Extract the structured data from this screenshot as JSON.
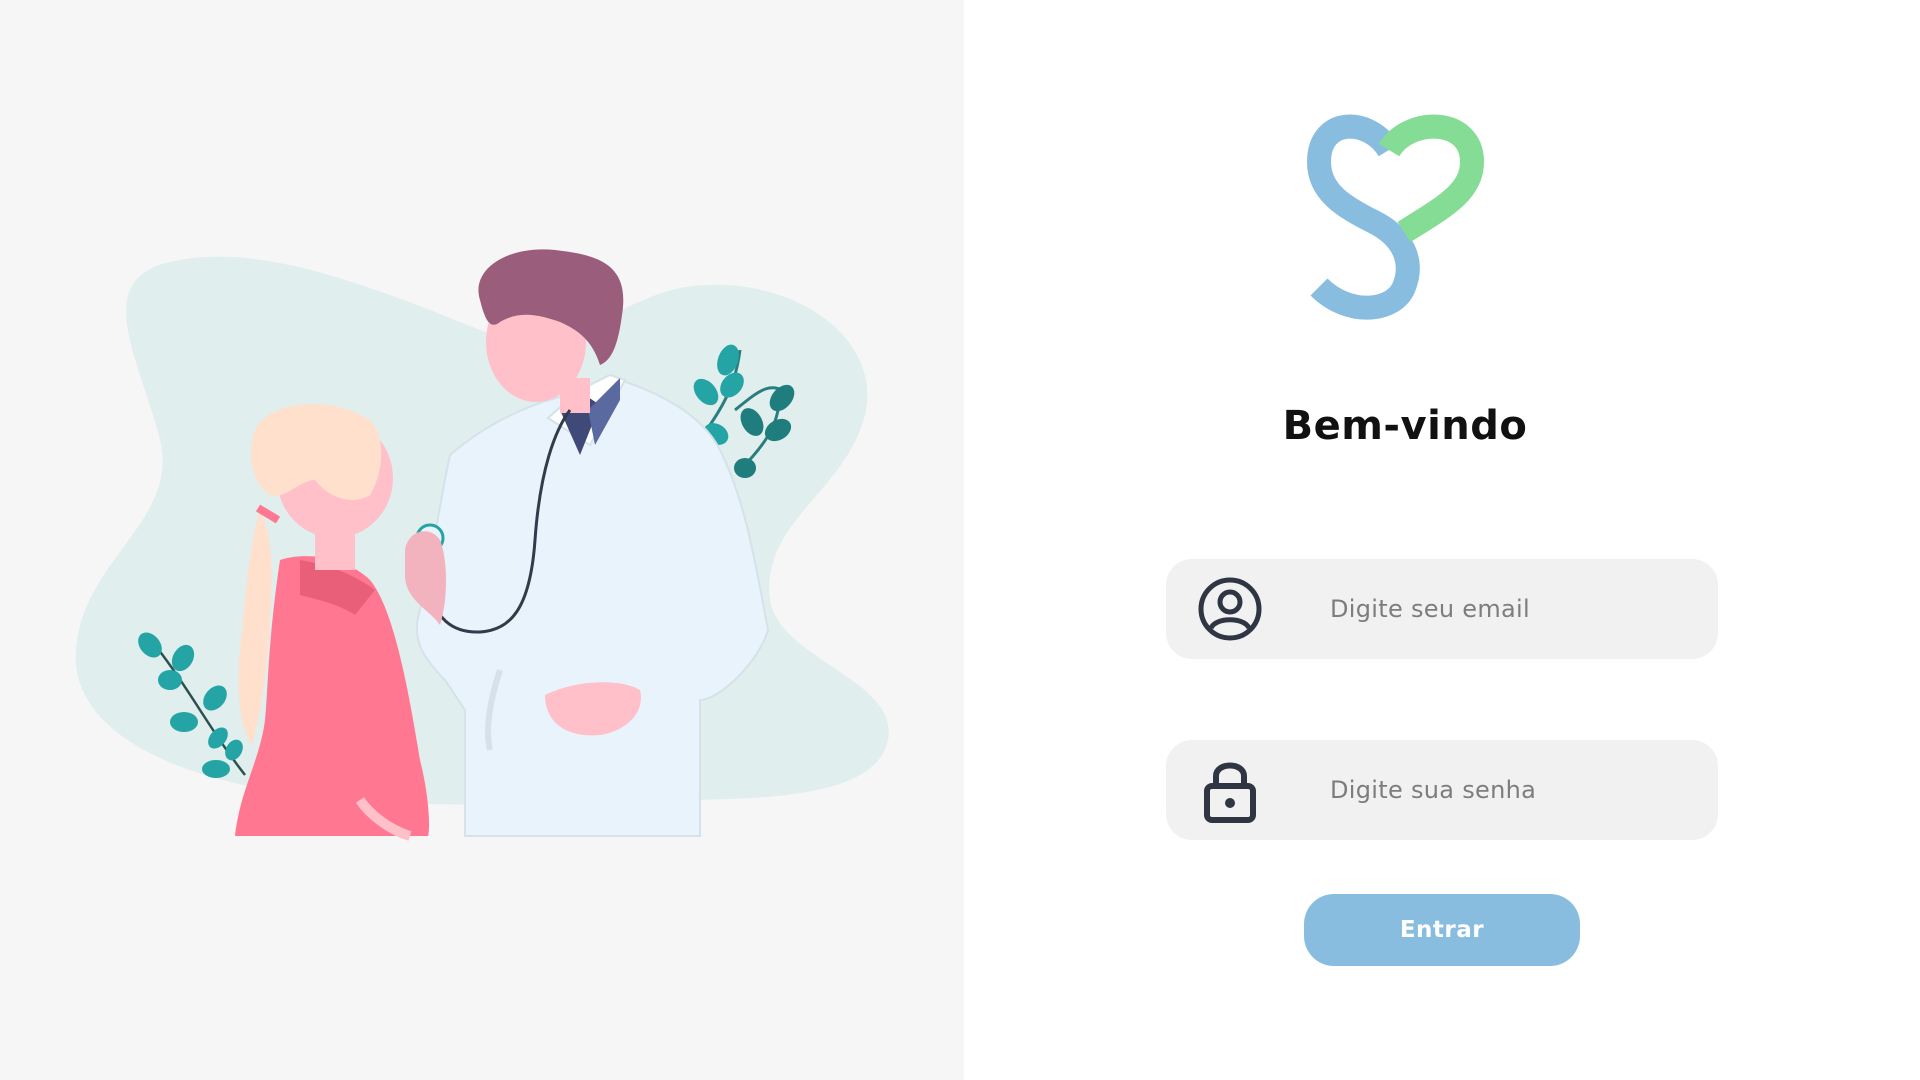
{
  "login": {
    "title": "Bem-vindo",
    "email_placeholder": "Digite seu email",
    "password_placeholder": "Digite sua senha",
    "submit_label": "Entrar"
  },
  "icons": {
    "logo": "heart-s-logo",
    "email": "user-circle-icon",
    "password": "lock-icon"
  },
  "colors": {
    "left_background": "#f6f6f6",
    "blob": "#e1eeee",
    "logo_blue": "#89bddf",
    "logo_green": "#84dc95",
    "button": "#89bddf",
    "input_background": "#f1f1f1",
    "icon_dark": "#2f3542"
  }
}
